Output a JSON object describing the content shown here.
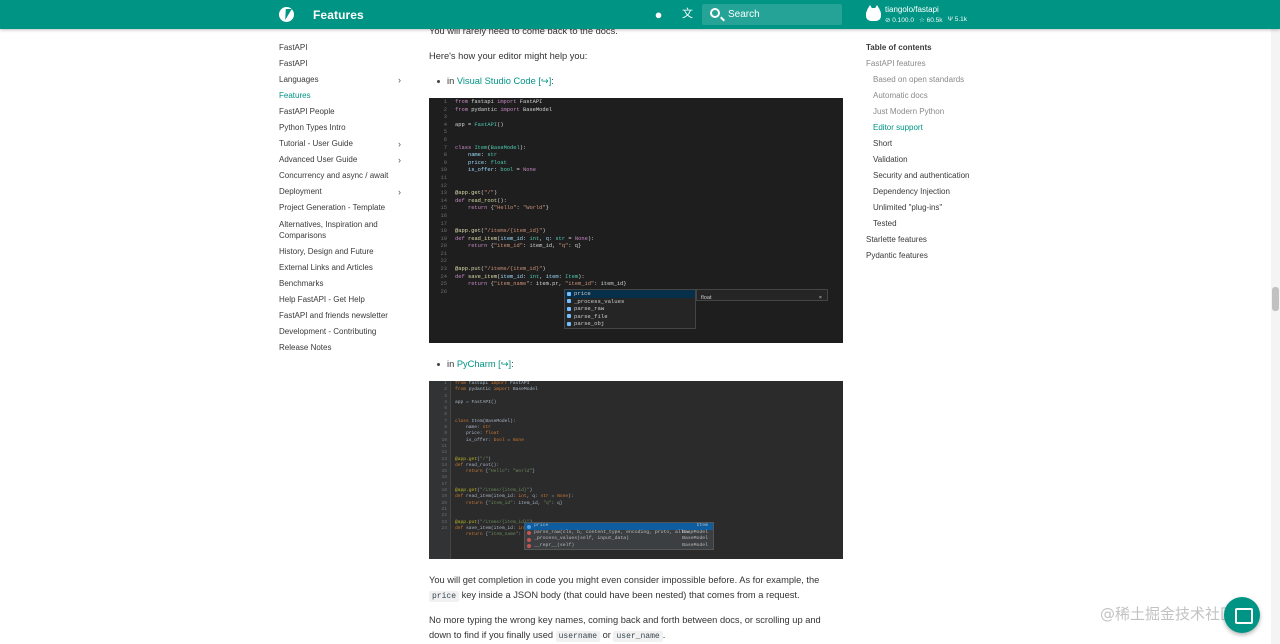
{
  "header": {
    "title": "Features",
    "search_placeholder": "Search",
    "repo_name": "tiangolo/fastapi",
    "repo_version": "0.100.0",
    "repo_stars": "60.5k",
    "repo_forks": "5.1k"
  },
  "nav": {
    "items": [
      {
        "label": "FastAPI"
      },
      {
        "label": "FastAPI"
      },
      {
        "label": "Languages"
      },
      {
        "label": "Features"
      },
      {
        "label": "FastAPI People"
      },
      {
        "label": "Python Types Intro"
      },
      {
        "label": "Tutorial - User Guide"
      },
      {
        "label": "Advanced User Guide"
      },
      {
        "label": "Concurrency and async / await"
      },
      {
        "label": "Deployment"
      },
      {
        "label": "Project Generation - Template"
      },
      {
        "label": "Alternatives, Inspiration and Comparisons"
      },
      {
        "label": "History, Design and Future"
      },
      {
        "label": "External Links and Articles"
      },
      {
        "label": "Benchmarks"
      },
      {
        "label": "Help FastAPI - Get Help"
      },
      {
        "label": "FastAPI and friends newsletter"
      },
      {
        "label": "Development - Contributing"
      },
      {
        "label": "Release Notes"
      }
    ]
  },
  "main": {
    "p_top": "You will rarely need to come back to the docs.",
    "p_editor": "Here's how your editor might help you:",
    "bullet1_prefix": "in ",
    "bullet1_link": "Visual Studio Code [↪]",
    "bullet1_suffix": ":",
    "bullet2_prefix": "in ",
    "bullet2_link": "PyCharm [↪]",
    "bullet2_suffix": ":",
    "p_completion_1": "You will get completion in code you might even consider impossible before. As for example, the",
    "code_price": "price",
    "p_completion_2": " key inside a JSON body (that could have been nested) that comes from a request.",
    "p_nomore_1": "No more typing the wrong key names, coming back and forth between docs, or scrolling up and",
    "p_nomore_2": "down to find if you finally used ",
    "code_username": "username",
    "p_nomore_or": " or ",
    "code_user_name": "user_name",
    "p_nomore_end": "."
  },
  "vscode": {
    "completions": [
      "price",
      "_process_values",
      "parse_raw",
      "parse_file",
      "parse_obj"
    ],
    "detail": "float",
    "detail_close": "×"
  },
  "pycharm": {
    "completions": [
      {
        "name": "price",
        "type": "Item"
      },
      {
        "name": "parse_raw(cls, b, content_type, encoding, proto, allow_",
        "type": "BaseModel"
      },
      {
        "name": "_process_values(self, input_data)",
        "type": "BaseModel"
      },
      {
        "name": "__repr__(self)",
        "type": "BaseModel"
      }
    ]
  },
  "toc": {
    "title": "Table of contents",
    "items": [
      {
        "label": "FastAPI features"
      },
      {
        "label": "Based on open standards"
      },
      {
        "label": "Automatic docs"
      },
      {
        "label": "Just Modern Python"
      },
      {
        "label": "Editor support"
      },
      {
        "label": "Short"
      },
      {
        "label": "Validation"
      },
      {
        "label": "Security and authentication"
      },
      {
        "label": "Dependency Injection"
      },
      {
        "label": "Unlimited \"plug-ins\""
      },
      {
        "label": "Tested"
      },
      {
        "label": "Starlette features"
      },
      {
        "label": "Pydantic features"
      }
    ]
  },
  "watermark": "@稀土掘金技术社区",
  "colors": {
    "accent": "#009485",
    "link": "#009485"
  }
}
